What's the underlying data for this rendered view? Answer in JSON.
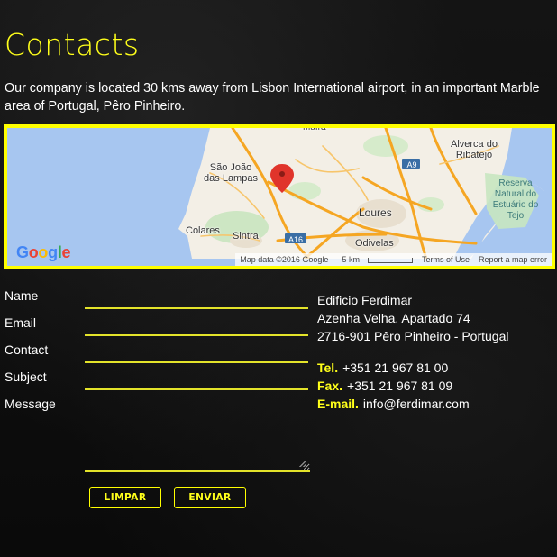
{
  "page": {
    "title": "Contacts",
    "intro": "Our company is located 30 kms away from Lisbon International airport, in an important Marble area of Portugal, Pêro Pinheiro."
  },
  "map": {
    "places": [
      "Alverca do Ribatejo",
      "São João das Lampas",
      "Loures",
      "Odivelas",
      "Colares",
      "Sintra",
      "Reserva Natural do Estuário do Tejo",
      "Mafra"
    ],
    "roads": [
      "A9",
      "A16"
    ],
    "logo": "Google",
    "footer": {
      "data": "Map data ©2016 Google",
      "scale": "5 km",
      "terms": "Terms of Use",
      "report": "Report a map error"
    }
  },
  "form": {
    "name_label": "Name",
    "email_label": "Email",
    "contact_label": "Contact",
    "subject_label": "Subject",
    "message_label": "Message",
    "clear_button": "LIMPAR",
    "send_button": "ENVIAR"
  },
  "address": {
    "company": "Edificio Ferdimar",
    "street": "Azenha Velha, Apartado 74",
    "postal": "2716-901 Pêro Pinheiro - Portugal"
  },
  "contacts": {
    "tel_label": "Tel.",
    "tel": "+351 21 967 81 00",
    "fax_label": "Fax.",
    "fax": "+351 21 967 81 09",
    "email_label": "E-mail.",
    "email": "info@ferdimar.com"
  },
  "colors": {
    "accent": "#ffff00",
    "background": "#0b0b0b",
    "text": "#ffffff"
  }
}
